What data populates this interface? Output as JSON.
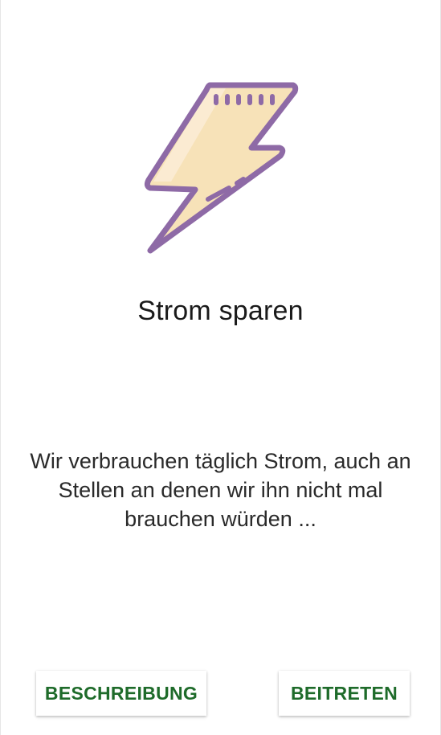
{
  "screen": {
    "title": "Strom sparen",
    "description": "Wir verbrauchen täglich Strom, auch an Stellen an denen wir ihn nicht mal brauchen würden ..."
  },
  "icon": {
    "name": "lightning-bolt-icon",
    "outline_color": "#8E6AA6",
    "fill_color": "#F7E2B8",
    "highlight_color": "#FBEBD2"
  },
  "buttons": {
    "description_label": "BESCHREIBUNG",
    "join_label": "BEITRETEN",
    "text_color": "#1E6B2A"
  }
}
